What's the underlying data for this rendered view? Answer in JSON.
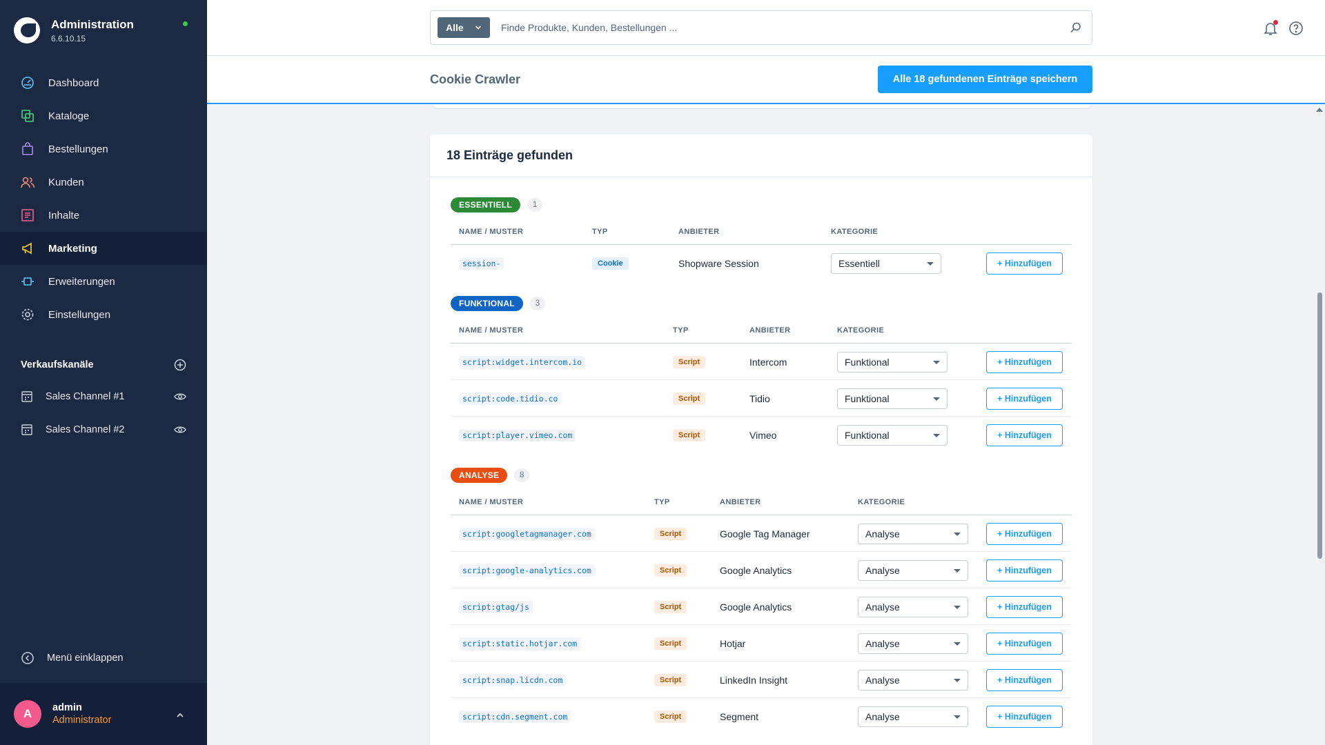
{
  "app": {
    "title": "Administration",
    "version": "6.6.10.15"
  },
  "nav": {
    "items": [
      {
        "label": "Dashboard",
        "icon": "dashboard-icon"
      },
      {
        "label": "Kataloge",
        "icon": "catalog-icon"
      },
      {
        "label": "Bestellungen",
        "icon": "shopping-bag-icon"
      },
      {
        "label": "Kunden",
        "icon": "users-icon"
      },
      {
        "label": "Inhalte",
        "icon": "content-icon"
      },
      {
        "label": "Marketing",
        "icon": "megaphone-icon",
        "active": true
      },
      {
        "label": "Erweiterungen",
        "icon": "plug-icon"
      },
      {
        "label": "Einstellungen",
        "icon": "gear-icon"
      }
    ],
    "collapse_label": "Menü einklappen"
  },
  "sales_channels": {
    "title": "Verkaufskanäle",
    "items": [
      {
        "label": "Sales Channel #1"
      },
      {
        "label": "Sales Channel #2"
      }
    ]
  },
  "user": {
    "initial": "A",
    "name": "admin",
    "role": "Administrator"
  },
  "search": {
    "type_label": "Alle",
    "placeholder": "Finde Produkte, Kunden, Bestellungen ..."
  },
  "smartbar": {
    "title": "Cookie Crawler",
    "save_all_label": "Alle 18 gefundenen Einträge speichern"
  },
  "results": {
    "title": "18 Einträge gefunden",
    "columns": {
      "name": "NAME / MUSTER",
      "type": "TYP",
      "provider": "ANBIETER",
      "category": "KATEGORIE"
    },
    "add_label": "+ Hinzufügen",
    "groups": [
      {
        "label": "ESSENTIELL",
        "count": "1",
        "color": "#2c8a36",
        "rows": [
          {
            "name": "session-",
            "type": "Cookie",
            "provider": "Shopware Session",
            "category": "Essentiell"
          }
        ]
      },
      {
        "label": "FUNKTIONAL",
        "count": "3",
        "color": "#0f65c6",
        "rows": [
          {
            "name": "script:widget.intercom.io",
            "type": "Script",
            "provider": "Intercom",
            "category": "Funktional"
          },
          {
            "name": "script:code.tidio.co",
            "type": "Script",
            "provider": "Tidio",
            "category": "Funktional"
          },
          {
            "name": "script:player.vimeo.com",
            "type": "Script",
            "provider": "Vimeo",
            "category": "Funktional"
          }
        ]
      },
      {
        "label": "ANALYSE",
        "count": "8",
        "color": "#e84e0f",
        "rows": [
          {
            "name": "script:googletagmanager.com",
            "type": "Script",
            "provider": "Google Tag Manager",
            "category": "Analyse"
          },
          {
            "name": "script:google-analytics.com",
            "type": "Script",
            "provider": "Google Analytics",
            "category": "Analyse"
          },
          {
            "name": "script:gtag/js",
            "type": "Script",
            "provider": "Google Analytics",
            "category": "Analyse"
          },
          {
            "name": "script:static.hotjar.com",
            "type": "Script",
            "provider": "Hotjar",
            "category": "Analyse"
          },
          {
            "name": "script:snap.licdn.com",
            "type": "Script",
            "provider": "LinkedIn Insight",
            "category": "Analyse"
          },
          {
            "name": "script:cdn.segment.com",
            "type": "Script",
            "provider": "Segment",
            "category": "Analyse"
          }
        ]
      }
    ]
  }
}
